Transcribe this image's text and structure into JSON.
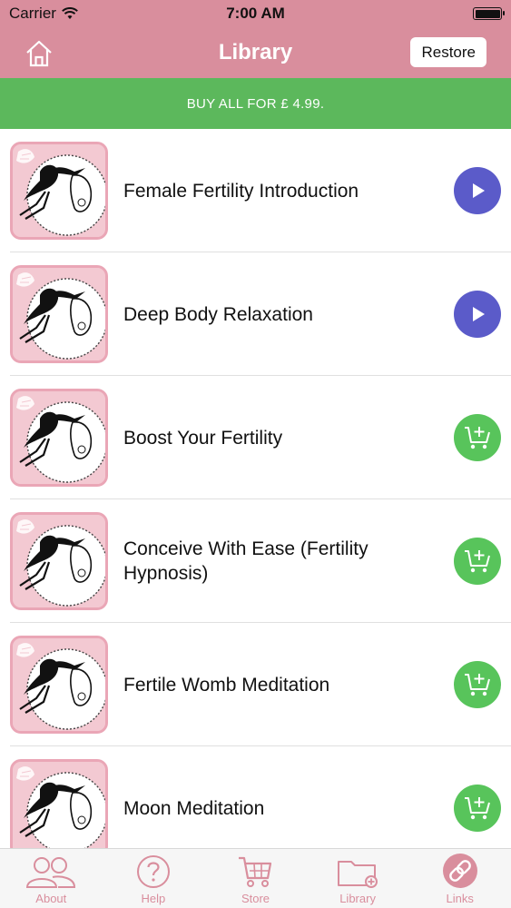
{
  "status_bar": {
    "carrier": "Carrier",
    "time": "7:00 AM"
  },
  "nav": {
    "title": "Library",
    "restore_label": "Restore"
  },
  "banner": {
    "text": "BUY ALL FOR £ 4.99."
  },
  "items": [
    {
      "title": "Female Fertility Introduction",
      "action": "play"
    },
    {
      "title": "Deep Body Relaxation",
      "action": "play"
    },
    {
      "title": "Boost Your Fertility",
      "action": "cart"
    },
    {
      "title": "Conceive With Ease (Fertility Hypnosis)",
      "action": "cart"
    },
    {
      "title": "Fertile Womb Meditation",
      "action": "cart"
    },
    {
      "title": "Moon Meditation",
      "action": "cart"
    }
  ],
  "tabs": [
    {
      "label": "About",
      "icon": "people-icon"
    },
    {
      "label": "Help",
      "icon": "question-icon"
    },
    {
      "label": "Store",
      "icon": "cart-icon"
    },
    {
      "label": "Library",
      "icon": "folder-icon"
    },
    {
      "label": "Links",
      "icon": "link-icon"
    }
  ],
  "colors": {
    "nav_pink": "#d98e9d",
    "banner_green": "#5cb85c",
    "play_blue": "#5b5bc9",
    "cart_green": "#58c45b"
  }
}
